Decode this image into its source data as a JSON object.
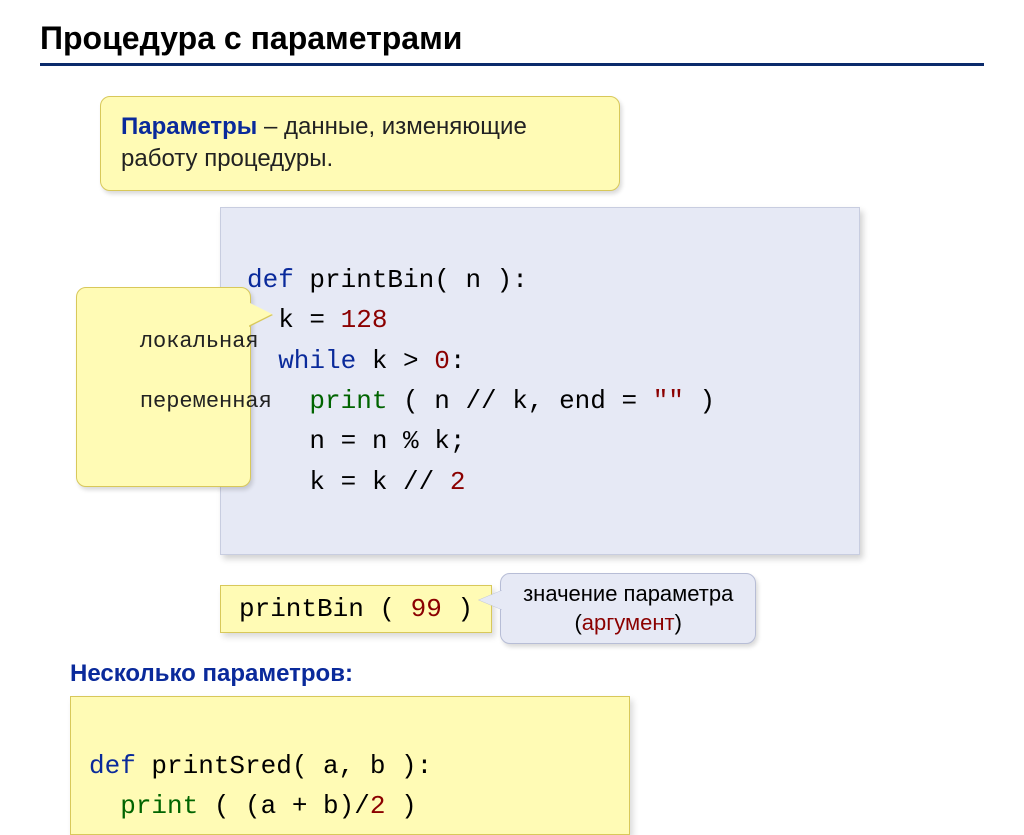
{
  "title": "Процедура с параметрами",
  "callout_top": {
    "term": "Параметры",
    "rest": " – данные, изменяющие работу процедуры."
  },
  "brace_char": "⏟",
  "main_code": {
    "l1_kw": "def",
    "l1_rest": " printBin( n ):",
    "l2_pre": "  k = ",
    "l2_num": "128",
    "l3_kw": "  while",
    "l3_rest": " k > ",
    "l3_num": "0",
    "l3_end": ":",
    "l4_pre": "    ",
    "l4_fn": "print",
    "l4_mid": " ( n // k, end = ",
    "l4_str": "\"\"",
    "l4_end": " )",
    "l5": "    n = n % k;",
    "l6_pre": "    k = k // ",
    "l6_num": "2"
  },
  "callout_left": {
    "line1": "локальная",
    "line2": "переменная"
  },
  "call_code": {
    "pre": "printBin ( ",
    "num": "99",
    "post": " )"
  },
  "callout_right": {
    "line1": "значение параметра",
    "line2_pre": "(",
    "line2_term": "аргумент",
    "line2_post": ")"
  },
  "subheader": "Несколько параметров:",
  "code_bottom": {
    "l1_kw": "def",
    "l1_rest": " printSred( a, b ):",
    "l2_pre": "  ",
    "l2_fn": "print",
    "l2_mid": " ( (a + b)/",
    "l2_num": "2",
    "l2_end": " )"
  }
}
